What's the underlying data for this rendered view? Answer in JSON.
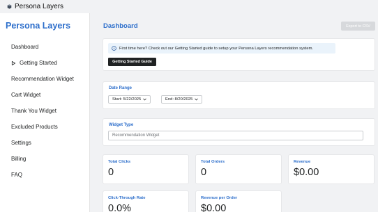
{
  "topbar": {
    "title": "Persona Layers"
  },
  "sidebar": {
    "brand": "Persona Layers",
    "items": [
      {
        "label": "Dashboard"
      },
      {
        "label": "Getting Started"
      },
      {
        "label": "Recommendation Widget"
      },
      {
        "label": "Cart Widget"
      },
      {
        "label": "Thank You Widget"
      },
      {
        "label": "Excluded Products"
      },
      {
        "label": "Settings"
      },
      {
        "label": "Billing"
      },
      {
        "label": "FAQ"
      }
    ]
  },
  "main": {
    "title": "Dashboard",
    "export_label": "Export to CSV",
    "info": {
      "text": "First time here? Check out our Getting Started guide to setup your Persona Layers recommendation system.",
      "button_label": "Getting Started Guide"
    },
    "date_range": {
      "label": "Date Range",
      "start": "Start: 5/22/2025",
      "end": "End: 8/20/2025"
    },
    "widget_type": {
      "label": "Widget Type",
      "selected": "Recommendation Widget"
    },
    "metrics": [
      {
        "label": "Total Clicks",
        "value": "0"
      },
      {
        "label": "Total Orders",
        "value": "0"
      },
      {
        "label": "Revenue",
        "value": "$0.00"
      },
      {
        "label": "Click-Through Rate",
        "value": "0.0%"
      },
      {
        "label": "Revenue per Order",
        "value": "$0.00"
      }
    ]
  },
  "colors": {
    "accent": "#2c6ecb",
    "background": "#f1f2f4",
    "info_bg": "#eaf3fb",
    "primary_button": "#202223",
    "disabled_button": "#d7d9dc"
  },
  "icons": {
    "app": "app-logo-icon",
    "getting_started": "play-arrow-icon",
    "info": "info-circle-icon",
    "dropdown": "chevron-down-icon"
  }
}
